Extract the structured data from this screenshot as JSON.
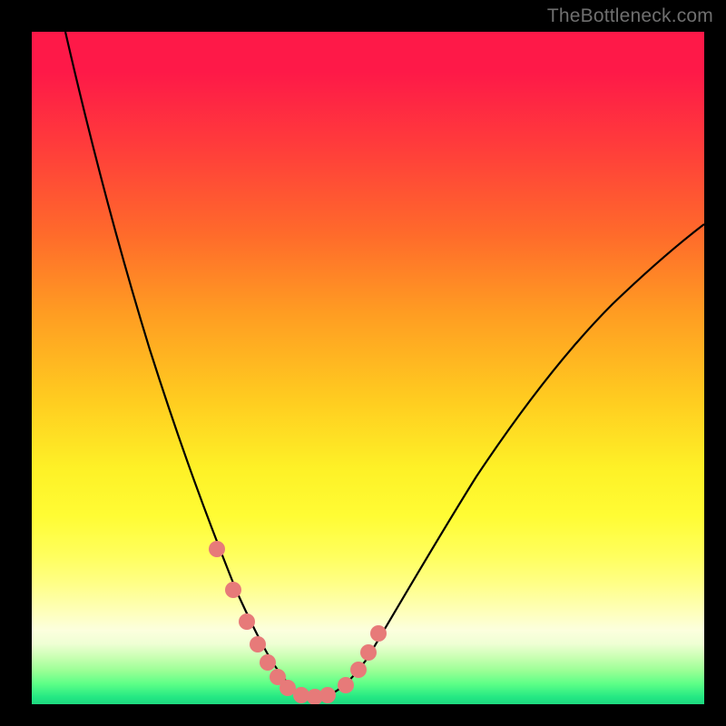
{
  "watermark": "TheBottleneck.com",
  "chart_data": {
    "type": "line",
    "title": "",
    "xlabel": "",
    "ylabel": "",
    "xlim": [
      0,
      100
    ],
    "ylim": [
      0,
      100
    ],
    "grid": false,
    "series": [
      {
        "name": "curve",
        "color": "#000000",
        "x": [
          5,
          10,
          15,
          20,
          24,
          27,
          30,
          32,
          34,
          36,
          38,
          40,
          42,
          45,
          50,
          55,
          60,
          65,
          70,
          75,
          80,
          85,
          90,
          95,
          100
        ],
        "y": [
          100,
          80,
          62,
          47,
          35,
          27,
          21,
          15,
          10,
          6,
          3,
          1,
          0,
          1,
          6,
          13,
          21,
          29,
          36,
          43,
          49,
          55,
          60,
          64,
          68
        ]
      },
      {
        "name": "dot-markers",
        "type": "scatter",
        "color": "#e77a79",
        "x": [
          27.5,
          30,
          32,
          33.5,
          35,
          36.5,
          38,
          40,
          42,
          44,
          46.5,
          48.5,
          50,
          51.5
        ],
        "y": [
          23,
          17,
          12,
          9,
          6,
          4,
          2.5,
          1,
          0.6,
          0.8,
          2.5,
          5,
          8,
          11
        ]
      }
    ],
    "gradient": {
      "top_color": "#fe1948",
      "mid_color": "#fef127",
      "bottom_color": "#1fd880"
    }
  }
}
